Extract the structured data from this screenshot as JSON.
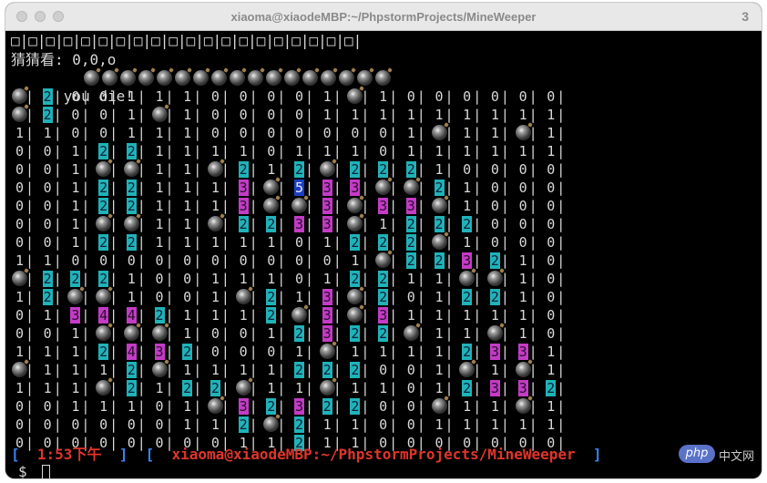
{
  "window": {
    "title": "xiaoma@xiaodeMBP:~/PhpstormProjects/MineWeeper",
    "tab_number": "3"
  },
  "terminal": {
    "header_row": "□|□|□|□|□|□|□|□|□|□|□|□|□|□|□|□|□|□|□|□|",
    "guess_line": "猜猜看: 0,0,o",
    "die_text": "you die!",
    "die_bombs": 17,
    "grid": [
      [
        "B",
        "2",
        "0",
        "0",
        "1",
        "1",
        "1",
        "0",
        "0",
        "0",
        "0",
        "1",
        "B",
        "1",
        "0",
        "0",
        "0",
        "0",
        "0",
        "0"
      ],
      [
        "B",
        "2",
        "0",
        "0",
        "1",
        "B",
        "1",
        "0",
        "0",
        "0",
        "0",
        "1",
        "1",
        "1",
        "1",
        "1",
        "1",
        "1",
        "1",
        "1"
      ],
      [
        "1",
        "1",
        "0",
        "0",
        "1",
        "1",
        "1",
        "0",
        "0",
        "0",
        "0",
        "0",
        "0",
        "0",
        "1",
        "B",
        "1",
        "1",
        "B",
        "1"
      ],
      [
        "0",
        "0",
        "1",
        "2",
        "2",
        "1",
        "1",
        "1",
        "1",
        "0",
        "1",
        "1",
        "1",
        "0",
        "1",
        "1",
        "1",
        "1",
        "1",
        "1"
      ],
      [
        "0",
        "0",
        "1",
        "B",
        "B",
        "1",
        "1",
        "B",
        "2",
        "1",
        "2",
        "B",
        "2",
        "2",
        "2",
        "1",
        "0",
        "0",
        "0",
        "0"
      ],
      [
        "0",
        "0",
        "1",
        "2",
        "2",
        "1",
        "1",
        "1",
        "3",
        "B",
        "5",
        "3",
        "3",
        "B",
        "B",
        "2",
        "1",
        "0",
        "0",
        "0"
      ],
      [
        "0",
        "0",
        "1",
        "2",
        "2",
        "1",
        "1",
        "1",
        "3",
        "B",
        "B",
        "3",
        "B",
        "3",
        "3",
        "B",
        "1",
        "0",
        "0",
        "0"
      ],
      [
        "0",
        "0",
        "1",
        "B",
        "B",
        "1",
        "1",
        "B",
        "2",
        "2",
        "3",
        "3",
        "B",
        "1",
        "2",
        "2",
        "2",
        "0",
        "0",
        "0"
      ],
      [
        "0",
        "0",
        "1",
        "2",
        "2",
        "1",
        "1",
        "1",
        "1",
        "1",
        "0",
        "1",
        "2",
        "2",
        "2",
        "B",
        "1",
        "0",
        "0",
        "0"
      ],
      [
        "1",
        "1",
        "0",
        "0",
        "0",
        "0",
        "0",
        "0",
        "0",
        "0",
        "0",
        "0",
        "1",
        "B",
        "2",
        "2",
        "3",
        "2",
        "1",
        "0"
      ],
      [
        "B",
        "2",
        "2",
        "2",
        "1",
        "0",
        "0",
        "1",
        "1",
        "1",
        "0",
        "1",
        "2",
        "2",
        "1",
        "1",
        "B",
        "B",
        "1",
        "0"
      ],
      [
        "1",
        "2",
        "B",
        "B",
        "1",
        "0",
        "0",
        "1",
        "B",
        "2",
        "1",
        "3",
        "B",
        "2",
        "0",
        "1",
        "2",
        "2",
        "1",
        "0"
      ],
      [
        "0",
        "1",
        "3",
        "4",
        "4",
        "2",
        "1",
        "1",
        "1",
        "2",
        "B",
        "3",
        "B",
        "3",
        "1",
        "1",
        "1",
        "1",
        "1",
        "0"
      ],
      [
        "0",
        "0",
        "1",
        "B",
        "B",
        "B",
        "1",
        "0",
        "0",
        "1",
        "2",
        "3",
        "2",
        "2",
        "B",
        "1",
        "1",
        "B",
        "1",
        "0"
      ],
      [
        "1",
        "1",
        "1",
        "2",
        "4",
        "3",
        "2",
        "0",
        "0",
        "0",
        "1",
        "B",
        "1",
        "1",
        "1",
        "1",
        "2",
        "3",
        "3",
        "1"
      ],
      [
        "B",
        "1",
        "1",
        "1",
        "2",
        "B",
        "1",
        "1",
        "1",
        "1",
        "2",
        "2",
        "2",
        "0",
        "0",
        "1",
        "B",
        "1",
        "B",
        "1"
      ],
      [
        "1",
        "1",
        "1",
        "B",
        "2",
        "1",
        "2",
        "2",
        "B",
        "1",
        "1",
        "B",
        "1",
        "1",
        "0",
        "1",
        "2",
        "3",
        "3",
        "2"
      ],
      [
        "0",
        "0",
        "1",
        "1",
        "1",
        "0",
        "1",
        "B",
        "3",
        "2",
        "3",
        "2",
        "2",
        "0",
        "0",
        "B",
        "1",
        "1",
        "B",
        "1"
      ],
      [
        "0",
        "0",
        "0",
        "0",
        "0",
        "0",
        "1",
        "1",
        "2",
        "B",
        "2",
        "1",
        "1",
        "0",
        "0",
        "1",
        "1",
        "1",
        "1",
        "1"
      ],
      [
        "0",
        "0",
        "0",
        "0",
        "0",
        "0",
        "0",
        "0",
        "1",
        "1",
        "2",
        "1",
        "1",
        "0",
        "0",
        "0",
        "0",
        "0",
        "0",
        "0"
      ]
    ],
    "prompt_time": "1:53下午",
    "prompt_path": "xiaoma@xiaodeMBP:~/PhpstormProjects/MineWeeper",
    "prompt_symbol": "$"
  },
  "watermark": {
    "logo_text": "php",
    "site_text": "中文网"
  }
}
